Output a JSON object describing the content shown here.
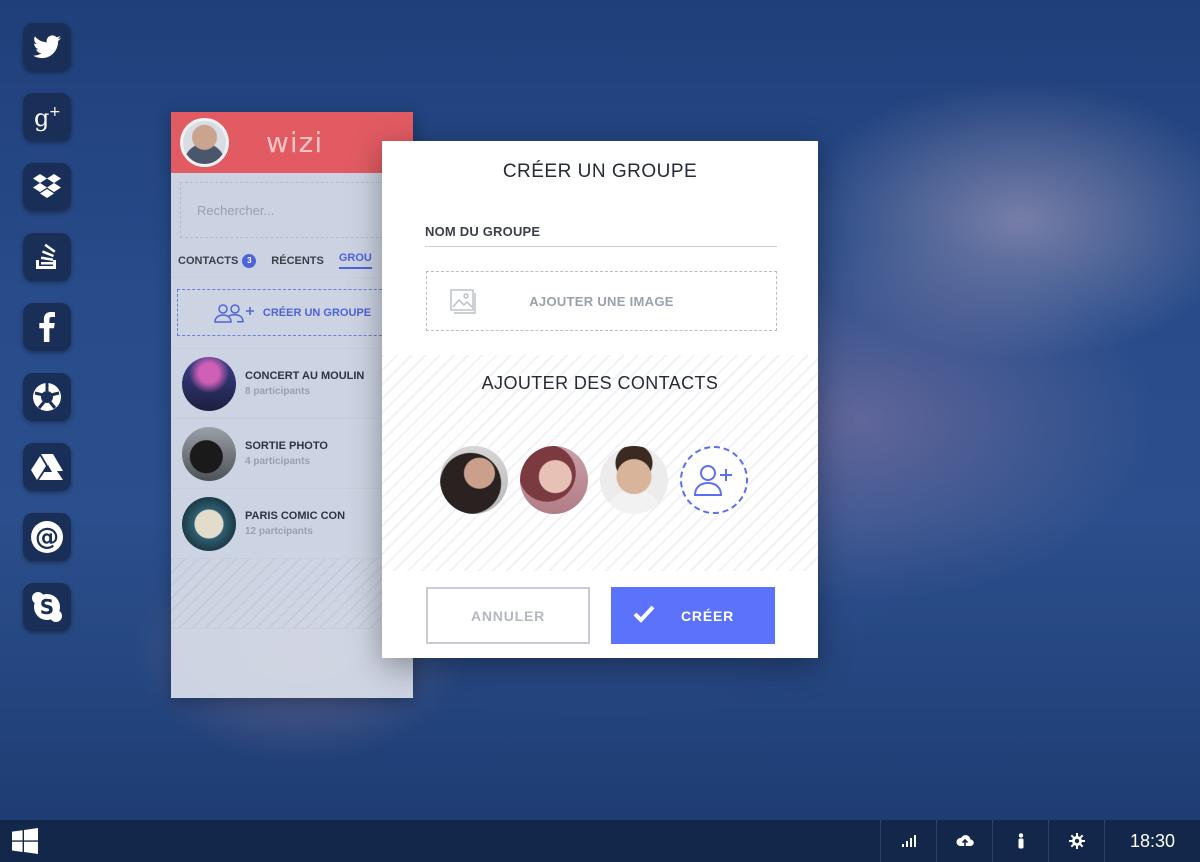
{
  "dock": {
    "items": [
      {
        "icon": "twitter-icon"
      },
      {
        "icon": "google-plus-icon"
      },
      {
        "icon": "dropbox-icon"
      },
      {
        "icon": "stack-overflow-icon"
      },
      {
        "icon": "facebook-icon"
      },
      {
        "icon": "picasa-icon"
      },
      {
        "icon": "google-drive-icon"
      },
      {
        "icon": "email-at-icon"
      },
      {
        "icon": "skype-icon"
      }
    ]
  },
  "app": {
    "logo": "wizi",
    "search_placeholder": "Rechercher...",
    "tabs": [
      {
        "label": "CONTACTS",
        "badge": "3"
      },
      {
        "label": "RÉCENTS"
      },
      {
        "label": "GROU"
      }
    ],
    "create_group_label": "CRÉER UN GROUPE",
    "groups": [
      {
        "name": "CONCERT AU MOULIN",
        "meta": "8 participants"
      },
      {
        "name": "SORTIE PHOTO",
        "meta": "4 participants"
      },
      {
        "name": "PARIS COMIC CON",
        "meta": "12 partcipants"
      }
    ],
    "accent_color": "#e25b62"
  },
  "modal": {
    "title": "CRÉER UN GROUPE",
    "group_name_label": "NOM DU GROUPE",
    "add_image_label": "AJOUTER UNE IMAGE",
    "contacts_title": "AJOUTER DES CONTACTS",
    "cancel_label": "ANNULER",
    "create_label": "CRÉER",
    "primary_color": "#5b72fb"
  },
  "taskbar": {
    "tray_icons": [
      "signal-icon",
      "cloud-upload-icon",
      "person-icon",
      "gear-icon"
    ],
    "clock": "18:30"
  }
}
